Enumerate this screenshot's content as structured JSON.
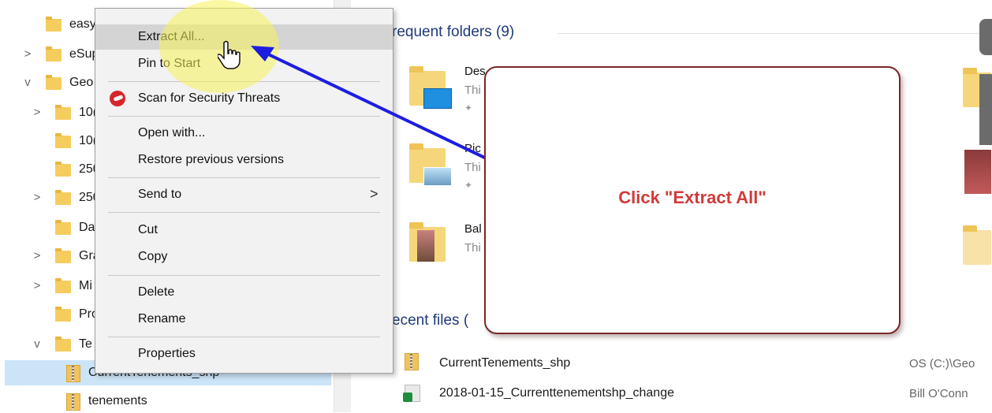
{
  "nav": {
    "items": [
      {
        "label": "easy",
        "expand": ""
      },
      {
        "label": "eSup",
        "expand": ">"
      },
      {
        "label": "Geo",
        "expand": "v"
      },
      {
        "label": "10(",
        "expand": ">"
      },
      {
        "label": "10(",
        "expand": ""
      },
      {
        "label": "250",
        "expand": ""
      },
      {
        "label": "250",
        "expand": ">"
      },
      {
        "label": "Da",
        "expand": ""
      },
      {
        "label": "Gra",
        "expand": ">"
      },
      {
        "label": "Mi",
        "expand": ">"
      },
      {
        "label": "Pro",
        "expand": ""
      },
      {
        "label": "Te",
        "expand": "v"
      },
      {
        "label": "CurrentTenements_shp",
        "expand": ""
      },
      {
        "label": "tenements",
        "expand": ""
      }
    ]
  },
  "content": {
    "frequent_heading": "requent folders (9)",
    "frequent": [
      {
        "title": "Des",
        "sub": "Thi"
      },
      {
        "title": "Pic",
        "sub": "Thi"
      },
      {
        "title": "Bal",
        "sub": "Thi"
      }
    ],
    "recent_heading": "ecent files (",
    "recent": [
      {
        "name": "CurrentTenements_shp",
        "location": "OS (C:)\\Geo"
      },
      {
        "name": "2018-01-15_Currenttenementshp_change",
        "location": "Bill O'Conn"
      }
    ]
  },
  "menu": {
    "items": [
      {
        "label": "Extract All..."
      },
      {
        "label": "Pin to Start"
      },
      {
        "label": "Scan for Security Threats"
      },
      {
        "label": "Open with..."
      },
      {
        "label": "Restore previous versions"
      },
      {
        "label": "Send to",
        "submenu": ">"
      },
      {
        "label": "Cut"
      },
      {
        "label": "Copy"
      },
      {
        "label": "Delete"
      },
      {
        "label": "Rename"
      },
      {
        "label": "Properties"
      }
    ]
  },
  "callout": {
    "text": "Click \"Extract All\""
  },
  "colors": {
    "arrow": "#1d1de0",
    "callout_border": "#7a2727",
    "callout_text": "#d03b3b",
    "highlight": "#f8f25a",
    "selection": "#cce4f7"
  },
  "icons": [
    "folder-icon",
    "zip-folder-icon",
    "chevron-right-icon",
    "chevron-down-icon",
    "security-scan-icon",
    "pin-icon",
    "hand-cursor-icon",
    "excel-file-icon"
  ]
}
